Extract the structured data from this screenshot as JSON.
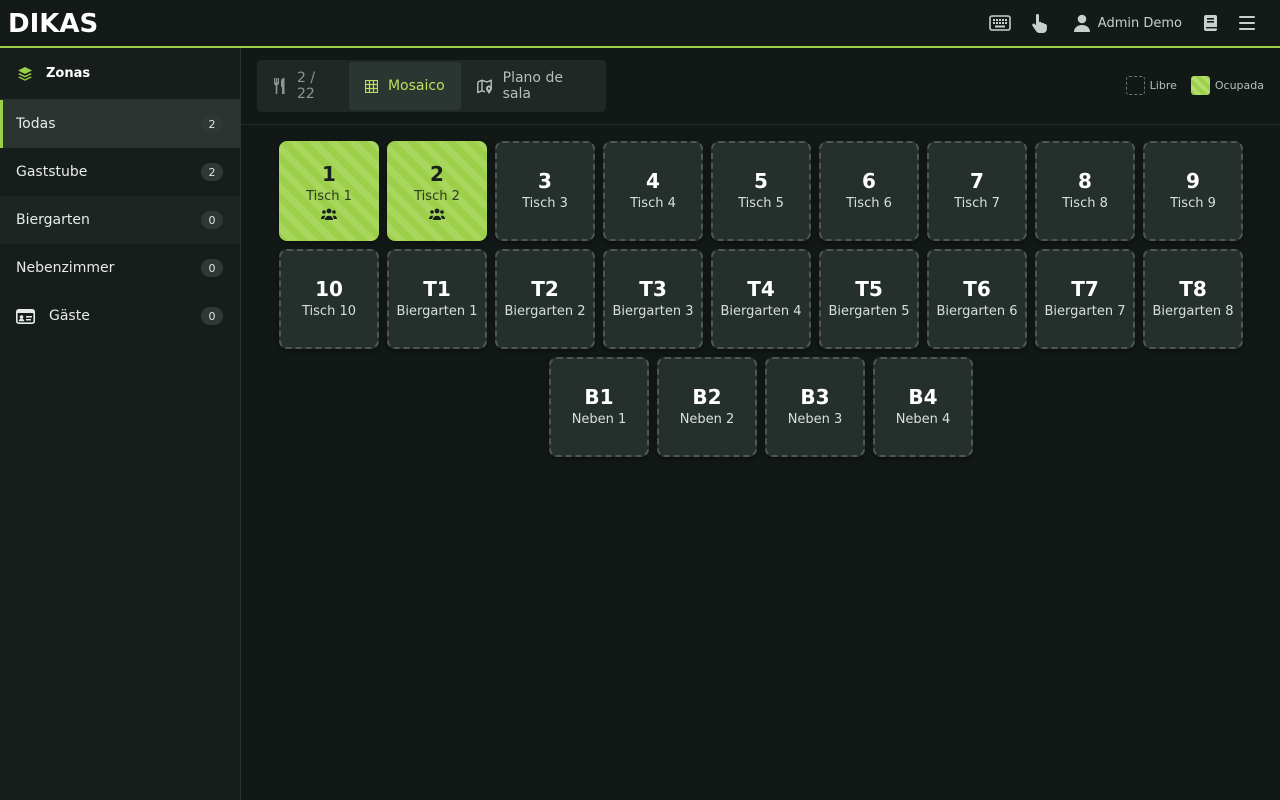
{
  "header": {
    "logo": "DIKAS",
    "user_name": "Admin Demo",
    "icons": [
      "keyboard-icon",
      "hand-pointer-icon",
      "user-icon",
      "book-icon",
      "menu-icon"
    ]
  },
  "sidebar": {
    "title": "Zonas",
    "items": [
      {
        "label": "Todas",
        "count": "2"
      },
      {
        "label": "Gaststube",
        "count": "2"
      },
      {
        "label": "Biergarten",
        "count": "0"
      },
      {
        "label": "Nebenzimmer",
        "count": "0"
      },
      {
        "label": "Gäste",
        "count": "0"
      }
    ]
  },
  "toolbar": {
    "occupancy": "2 / 22",
    "view_mosaic": "Mosaico",
    "view_floorplan": "Plano de sala",
    "legend_free": "Libre",
    "legend_occupied": "Ocupada"
  },
  "tables": [
    {
      "num": "1",
      "name": "Tisch 1",
      "occupied": true
    },
    {
      "num": "2",
      "name": "Tisch 2",
      "occupied": true
    },
    {
      "num": "3",
      "name": "Tisch 3",
      "occupied": false
    },
    {
      "num": "4",
      "name": "Tisch 4",
      "occupied": false
    },
    {
      "num": "5",
      "name": "Tisch 5",
      "occupied": false
    },
    {
      "num": "6",
      "name": "Tisch 6",
      "occupied": false
    },
    {
      "num": "7",
      "name": "Tisch 7",
      "occupied": false
    },
    {
      "num": "8",
      "name": "Tisch 8",
      "occupied": false
    },
    {
      "num": "9",
      "name": "Tisch 9",
      "occupied": false
    },
    {
      "num": "10",
      "name": "Tisch 10",
      "occupied": false
    },
    {
      "num": "T1",
      "name": "Biergarten 1",
      "occupied": false
    },
    {
      "num": "T2",
      "name": "Biergarten 2",
      "occupied": false
    },
    {
      "num": "T3",
      "name": "Biergarten 3",
      "occupied": false
    },
    {
      "num": "T4",
      "name": "Biergarten 4",
      "occupied": false
    },
    {
      "num": "T5",
      "name": "Biergarten 5",
      "occupied": false
    },
    {
      "num": "T6",
      "name": "Biergarten 6",
      "occupied": false
    },
    {
      "num": "T7",
      "name": "Biergarten 7",
      "occupied": false
    },
    {
      "num": "T8",
      "name": "Biergarten 8",
      "occupied": false
    },
    {
      "num": "B1",
      "name": "Neben 1",
      "occupied": false
    },
    {
      "num": "B2",
      "name": "Neben 2",
      "occupied": false
    },
    {
      "num": "B3",
      "name": "Neben 3",
      "occupied": false
    },
    {
      "num": "B4",
      "name": "Neben 4",
      "occupied": false
    }
  ],
  "colors": {
    "accent": "#9ccf4a",
    "active_text": "#b8e05c",
    "background": "#121816",
    "tile": "#25302c"
  }
}
